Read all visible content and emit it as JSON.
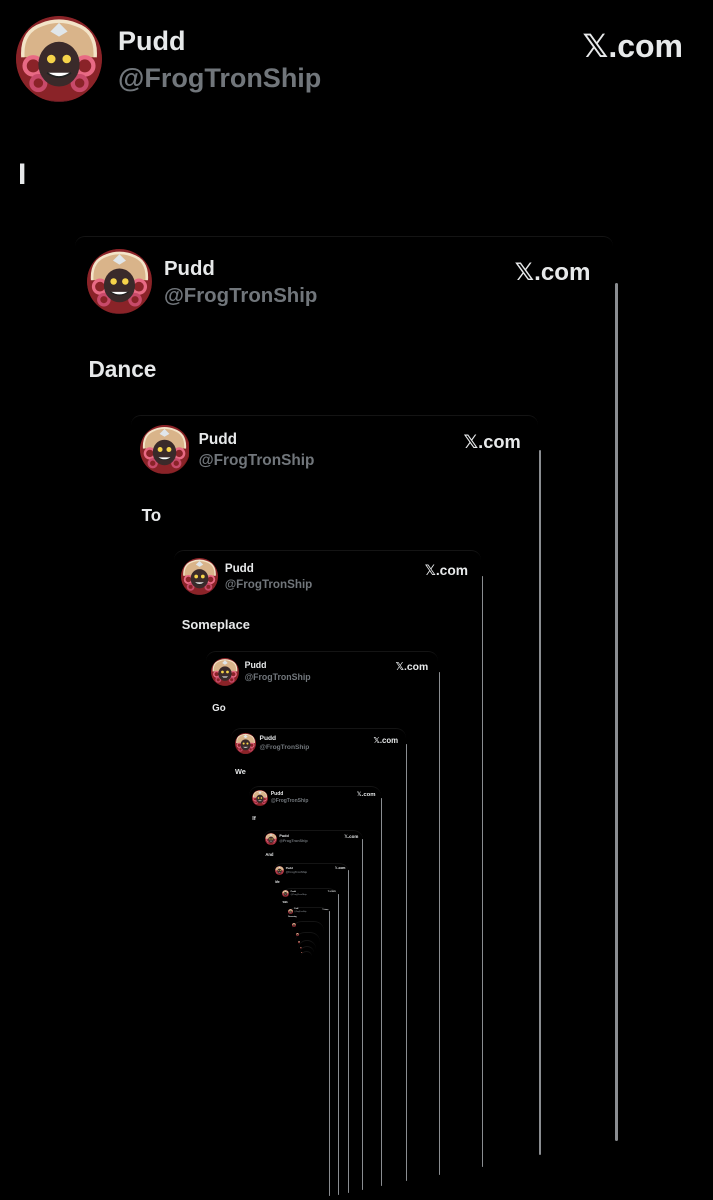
{
  "post": {
    "display_name": "Pudd",
    "handle": "@FrogTronShip",
    "site_label": ".com",
    "site_logo": "𝕏",
    "avatar_icon": "avatar-icon"
  },
  "words": [
    "I",
    "Dance",
    "To",
    "Someplace",
    "Go",
    "We",
    "If",
    "And",
    "Me",
    "With",
    "Dreaming",
    "...",
    "...",
    "...",
    "...",
    "..."
  ],
  "colors": {
    "background": "#000000",
    "text_primary": "#e7e9ea",
    "text_secondary": "#71767b",
    "scrollbar": "#8a8d91"
  }
}
